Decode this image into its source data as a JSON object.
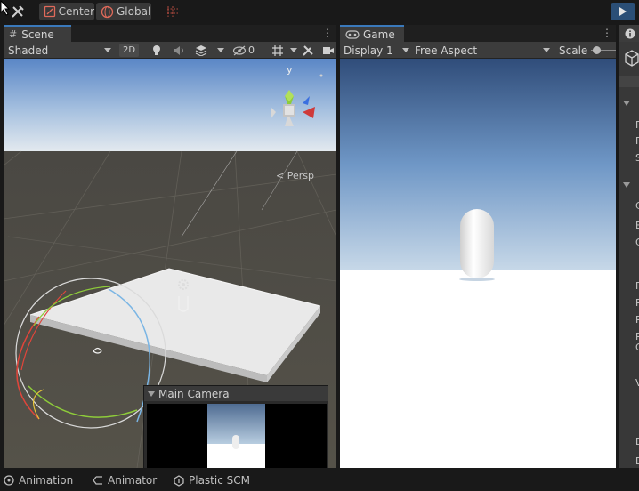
{
  "toolbar": {
    "pivot_mode": "Center",
    "pivot_rotation": "Global"
  },
  "scene": {
    "tab_label": "Scene",
    "draw_mode": "Shaded",
    "toggle_2d": "2D",
    "hidden_count": "0",
    "gizmo_axis_y": "y",
    "gizmo_label": "< Persp"
  },
  "camera_preview": {
    "title": "Main Camera"
  },
  "game": {
    "tab_label": "Game",
    "display": "Display 1",
    "aspect": "Free Aspect",
    "scale_label": "Scale"
  },
  "inspector": {
    "strip_letters": [
      "R",
      "R",
      "S",
      "C",
      "E",
      "C",
      "P",
      "R",
      "R",
      "R",
      "C",
      "V",
      "D",
      "D"
    ]
  },
  "bottom_tabs": {
    "animation": "Animation",
    "animator": "Animator",
    "plastic": "Plastic SCM"
  },
  "colors": {
    "accent": "#3a79bb",
    "panel": "#282828",
    "toolbar": "#191919"
  }
}
